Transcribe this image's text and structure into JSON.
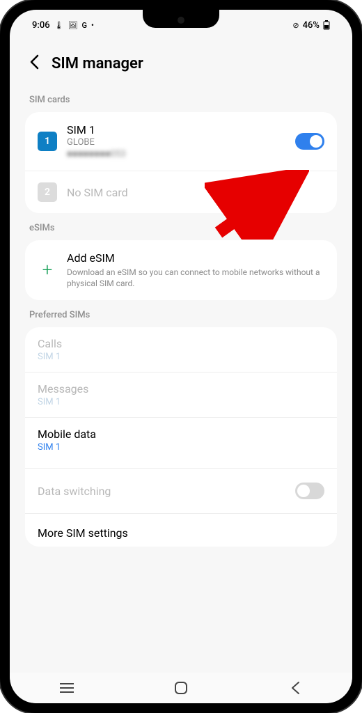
{
  "status": {
    "time": "9:06",
    "battery": "46%",
    "icons_left": [
      "🌡",
      "🖼",
      "G",
      "•"
    ],
    "icon_nodist": "⊘"
  },
  "header": {
    "title": "SIM manager"
  },
  "sections": {
    "sim_cards": {
      "label": "SIM cards",
      "sim1": {
        "title": "SIM 1",
        "carrier": "GLOBE",
        "number": "■■■■■■■■053",
        "toggle_on": true
      },
      "sim2": {
        "title": "No SIM card"
      }
    },
    "esims": {
      "label": "eSIMs",
      "add": {
        "title": "Add eSIM",
        "desc": "Download an eSIM so you can connect to mobile networks without a physical SIM card."
      }
    },
    "preferred": {
      "label": "Preferred SIMs",
      "calls": {
        "title": "Calls",
        "value": "SIM 1",
        "enabled": false
      },
      "messages": {
        "title": "Messages",
        "value": "SIM 1",
        "enabled": false
      },
      "mobile_data": {
        "title": "Mobile data",
        "value": "SIM 1",
        "enabled": true
      },
      "data_switching": {
        "title": "Data switching",
        "toggle_on": false,
        "enabled": false
      }
    },
    "more": {
      "title": "More SIM settings"
    }
  }
}
